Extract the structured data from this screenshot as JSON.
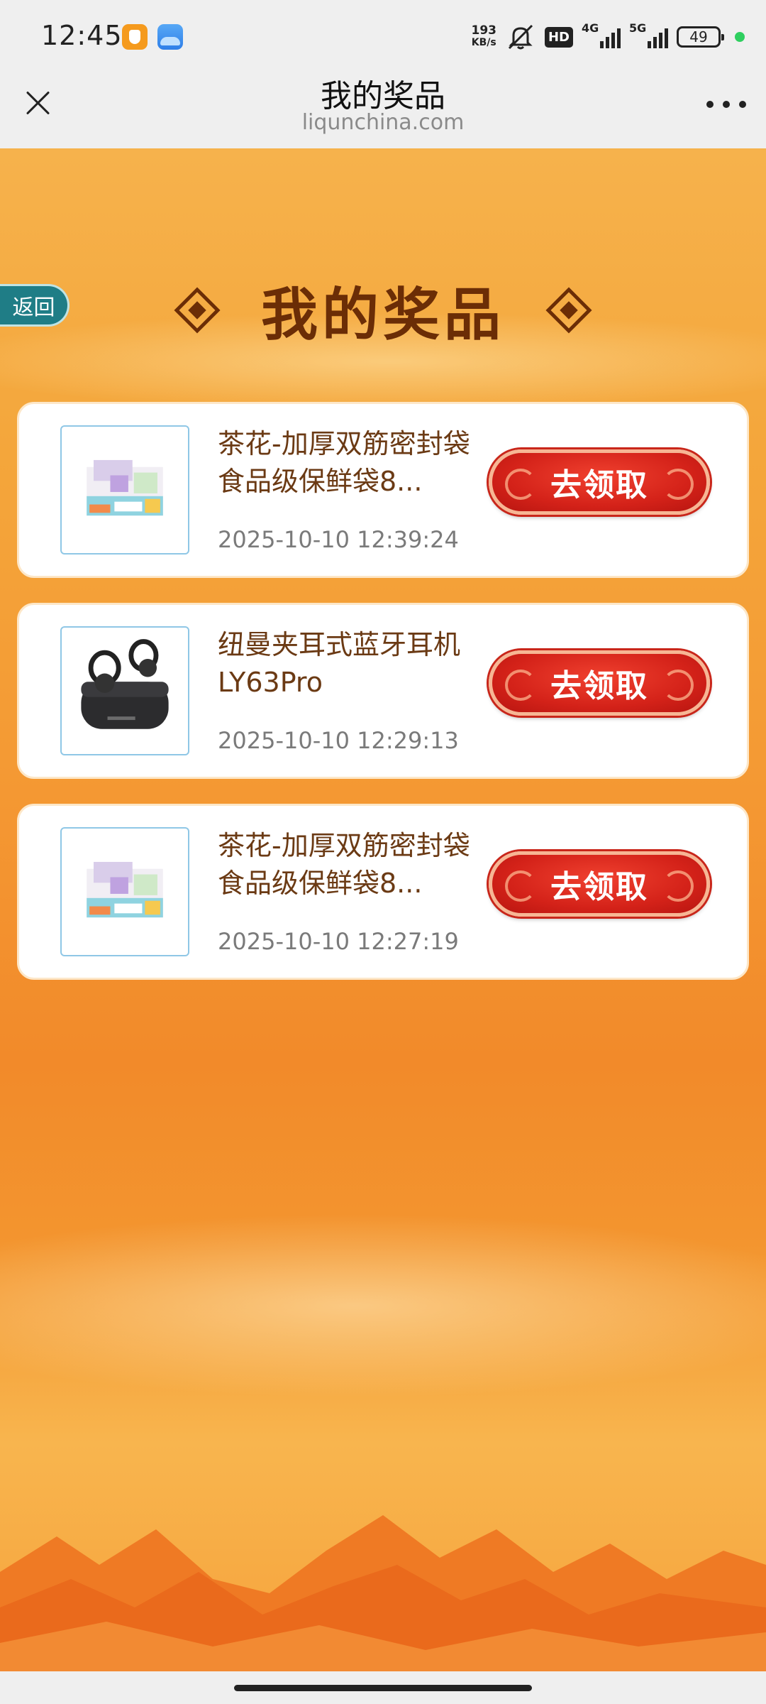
{
  "status_bar": {
    "time": "12:45",
    "net_speed_value": "193",
    "net_speed_unit": "KB/s",
    "hd_label": "HD",
    "signal1_label": "4G",
    "signal2_label": "5G",
    "battery": "49"
  },
  "title_bar": {
    "title": "我的奖品",
    "domain": "liqunchina.com"
  },
  "page": {
    "back_label": "返回",
    "heading": "我的奖品"
  },
  "prizes": [
    {
      "name": "茶花-加厚双筋密封袋食品级保鲜袋8...",
      "time": "2025-10-10 12:39:24",
      "button_label": "去领取",
      "thumb": "food-bags-box-image"
    },
    {
      "name": "纽曼夹耳式蓝牙耳机LY63Pro",
      "time": "2025-10-10 12:29:13",
      "button_label": "去领取",
      "thumb": "earbuds-image"
    },
    {
      "name": "茶花-加厚双筋密封袋食品级保鲜袋8...",
      "time": "2025-10-10 12:27:19",
      "button_label": "去领取",
      "thumb": "food-bags-box-image"
    }
  ],
  "colors": {
    "heading": "#6b2d06",
    "button_red": "#d42219",
    "back_teal": "#1f7d86",
    "name_brown": "#6b3a14"
  }
}
